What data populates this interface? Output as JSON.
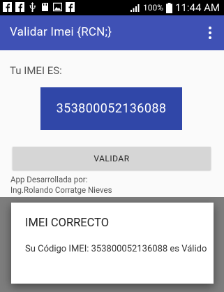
{
  "status_bar": {
    "icons_left": [
      "facebook-icon",
      "facebook-icon",
      "usb-icon",
      "sd-card-icon",
      "image-icon",
      "facebook-icon"
    ],
    "battery_percent": "100%",
    "time": "11:44 AM"
  },
  "app_bar": {
    "title": "Validar Imei {RCN;}",
    "color": "#3f51b5"
  },
  "main": {
    "imei_label": "Tu IMEI ES:",
    "imei_value": "353800052136088",
    "imei_box_color": "#3047a8",
    "validate_button": "VALIDAR",
    "credits_line1": "App Desarrollada por:",
    "credits_line2": "Ing.Rolando Corratge Nieves"
  },
  "dialog": {
    "title": "IMEI CORRECTO",
    "message": "Su Código IMEI: 353800052136088 es Válido"
  }
}
